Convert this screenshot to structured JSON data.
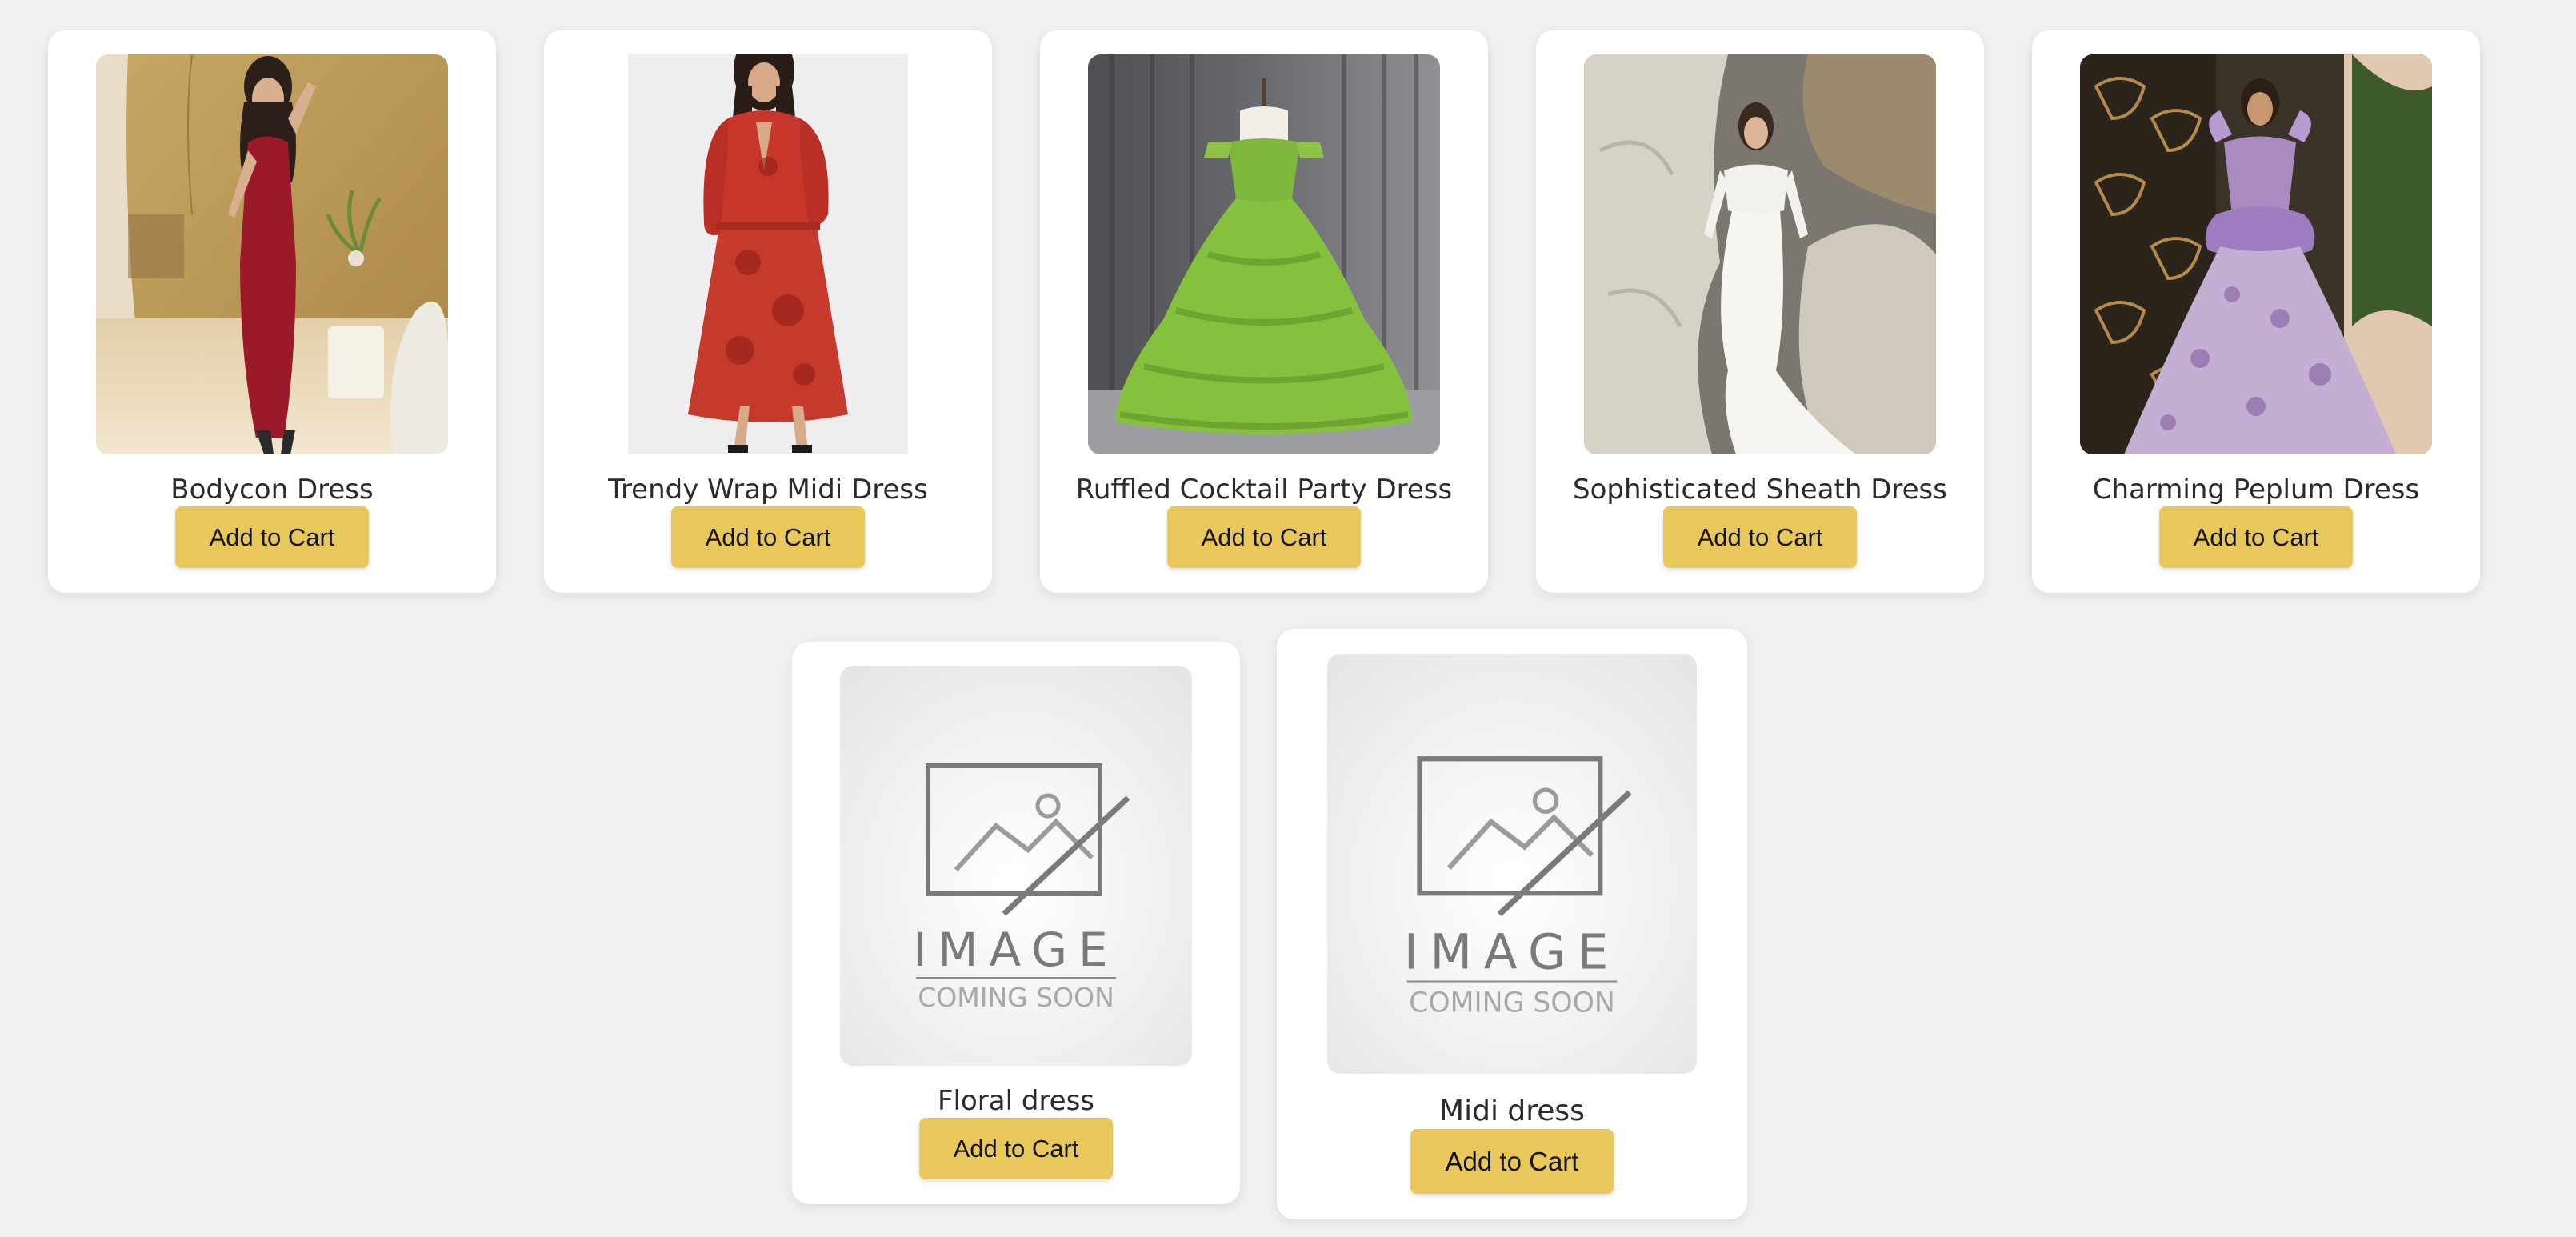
{
  "products": [
    {
      "name": "Bodycon Dress",
      "button_label": "Add to Cart",
      "image": "red-bodycon-dress-photo"
    },
    {
      "name": "Trendy Wrap Midi Dress",
      "button_label": "Add to Cart",
      "image": "red-floral-wrap-dress-photo"
    },
    {
      "name": "Ruffled Cocktail Party Dress",
      "button_label": "Add to Cart",
      "image": "green-ruffled-ball-gown-photo"
    },
    {
      "name": "Sophisticated Sheath Dress",
      "button_label": "Add to Cart",
      "image": "white-sheath-gown-photo"
    },
    {
      "name": "Charming Peplum Dress",
      "button_label": "Add to Cart",
      "image": "lilac-peplum-gown-photo"
    },
    {
      "name": "Floral dress",
      "button_label": "Add to Cart",
      "image": "image-coming-soon-placeholder",
      "placeholder_line1": "IMAGE",
      "placeholder_line2": "COMING SOON"
    },
    {
      "name": "Midi dress",
      "button_label": "Add to Cart",
      "image": "image-coming-soon-placeholder",
      "placeholder_line1": "IMAGE",
      "placeholder_line2": "COMING SOON"
    }
  ],
  "colors": {
    "page_background": "#eff0f2",
    "card_background": "#ffffff",
    "button_background": "#e8c75b",
    "title_text": "#2b2b2b"
  }
}
